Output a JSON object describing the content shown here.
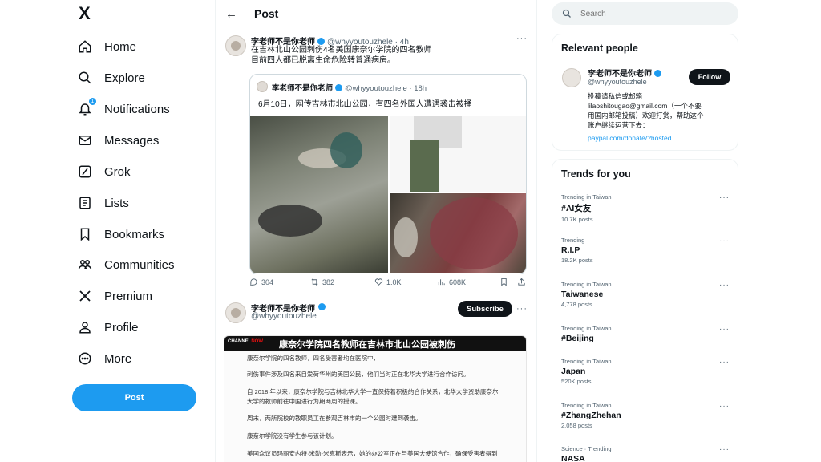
{
  "nav": {
    "logo": "X",
    "items": [
      {
        "label": "Home",
        "icon": "home-icon"
      },
      {
        "label": "Explore",
        "icon": "search-icon"
      },
      {
        "label": "Notifications",
        "icon": "bell-icon"
      },
      {
        "label": "Messages",
        "icon": "mail-icon"
      },
      {
        "label": "Grok",
        "icon": "grok-icon"
      },
      {
        "label": "Lists",
        "icon": "list-icon"
      },
      {
        "label": "Bookmarks",
        "icon": "bookmark-icon"
      },
      {
        "label": "Communities",
        "icon": "communities-icon"
      },
      {
        "label": "Premium",
        "icon": "x-icon"
      },
      {
        "label": "Profile",
        "icon": "person-icon"
      },
      {
        "label": "More",
        "icon": "more-circle-icon"
      }
    ],
    "notification_badge": "1",
    "post_button": "Post"
  },
  "header": {
    "title": "Post"
  },
  "tweet1": {
    "name": "李老师不是你老师",
    "handle": "@whyyoutouzhele · 4h",
    "text_line1": "在吉林北山公园刺伤4名美国康奈尔学院的四名教师",
    "text_line2": "目前四人都已脱离生命危险转普通病房。",
    "quote": {
      "name": "李老师不是你老师",
      "handle": "@whyyoutouzhele · 18h",
      "text": "6月10日，网传吉林市北山公园，有四名外国人遭遇袭击被捅"
    },
    "actions": {
      "replies": "304",
      "reposts": "382",
      "likes": "1.0K",
      "views": "608K"
    }
  },
  "tweet2": {
    "name": "李老师不是你老师",
    "handle": "@whyyoutouzhele",
    "subscribe": "Subscribe",
    "news": {
      "logo_a": "CHANNEL",
      "logo_b": "NOW",
      "headline": "康奈尔学院四名教师在吉林市北山公园被刺伤",
      "paragraphs": [
        "康奈尔学院的四名教师，四名受害者均在医院中，",
        "刺伤事件涉及四名来自爱荷华州的美国公民，他们当时正在北华大学进行合作访问。",
        "自 2018 年以来，康奈尔学院与吉林北华大学一直保持着积极的合作关系，北华大学资助康奈尔",
        "大学的教师前往中国进行为期两周的授课。",
        "周末，两所院校的教职员工在参观吉林市的一个公园时遭到袭击。",
        "康奈尔学院没有学生参与该计划。",
        "美国众议员玛丽安内特·米勒-米克斯表示，她的办公室正在与美国大使馆合作，确保受害者得到"
      ]
    }
  },
  "search": {
    "placeholder": "Search"
  },
  "relevant": {
    "title": "Relevant people",
    "name": "李老师不是你老师",
    "handle": "@whyyoutouzhele",
    "follow": "Follow",
    "bio_line1": "投稿请私信或邮箱",
    "bio_line2": "lilaoshitougao@gmail.com（一个不要",
    "bio_line3": "用国内邮箱投稿）欢迎打赏，帮助这个",
    "bio_line4": "账户继续运营下去：",
    "bio_link": "paypal.com/donate/?hosted…"
  },
  "trends": {
    "title": "Trends for you",
    "items": [
      {
        "meta": "Trending in Taiwan",
        "name": "#AI女友",
        "count": "10.7K posts"
      },
      {
        "meta": "Trending",
        "name": "R.I.P",
        "count": "18.2K posts"
      },
      {
        "meta": "Trending in Taiwan",
        "name": "Taiwanese",
        "count": "4,778 posts"
      },
      {
        "meta": "Trending in Taiwan",
        "name": "#Beijing",
        "count": ""
      },
      {
        "meta": "Trending in Taiwan",
        "name": "Japan",
        "count": "520K posts"
      },
      {
        "meta": "Trending in Taiwan",
        "name": "#ZhangZhehan",
        "count": "2,058 posts"
      },
      {
        "meta": "Science · Trending",
        "name": "NASA",
        "count": ""
      }
    ]
  }
}
